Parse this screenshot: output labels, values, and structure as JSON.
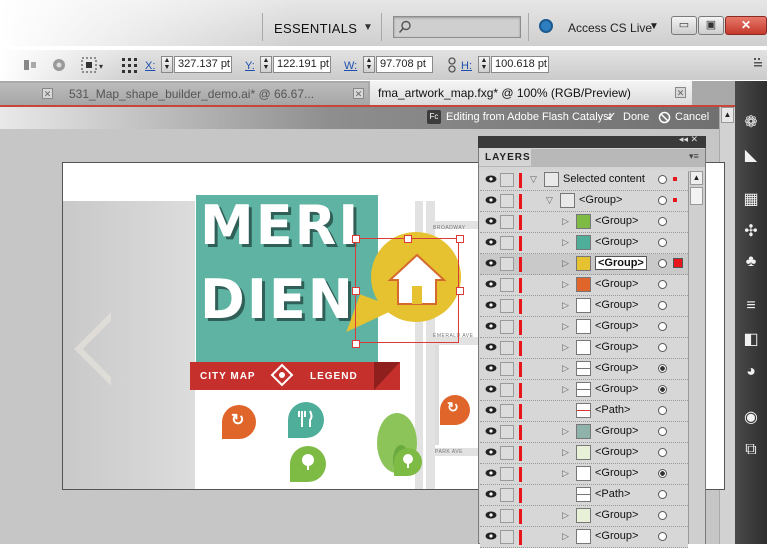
{
  "app": {
    "workspace": "ESSENTIALS",
    "search_placeholder": "",
    "cs_live": "Access CS Live",
    "window_buttons": {
      "minimize": "▭",
      "maximize": "▣",
      "close": "✕"
    }
  },
  "control_bar": {
    "x_label": "X:",
    "x_value": "327.137 pt",
    "y_label": "Y:",
    "y_value": "122.191 pt",
    "w_label": "W:",
    "w_value": "97.708 pt",
    "h_label": "H:",
    "h_value": "100.618 pt"
  },
  "tabs": [
    {
      "label": "531_Map_shape_builder_demo.ai* @ 66.67...",
      "active": false
    },
    {
      "label": "fma_artwork_map.fxg* @ 100% (RGB/Preview)",
      "active": true
    }
  ],
  "flash_bar": {
    "badge": "Fc",
    "text": "Editing from Adobe Flash Catalyst",
    "done": "Done",
    "cancel": "Cancel"
  },
  "layers_panel": {
    "title": "LAYERS",
    "rows": [
      {
        "label": "Selected content",
        "indent": 0,
        "expand": "down",
        "thumb": "folder",
        "target_filled": false
      },
      {
        "label": "<Group>",
        "indent": 1,
        "expand": "down",
        "thumb": "folder",
        "target_filled": false
      },
      {
        "label": "<Group>",
        "indent": 2,
        "expand": "right",
        "thumb": "green-pin",
        "target_filled": false
      },
      {
        "label": "<Group>",
        "indent": 2,
        "expand": "right",
        "thumb": "teal-pin",
        "target_filled": false
      },
      {
        "label": "<Group>",
        "indent": 2,
        "expand": "right",
        "thumb": "yellow-pin",
        "target_filled": false,
        "selected": true
      },
      {
        "label": "<Group>",
        "indent": 2,
        "expand": "right",
        "thumb": "orange-pin",
        "target_filled": false
      },
      {
        "label": "<Group>",
        "indent": 2,
        "expand": "right",
        "thumb": "blank",
        "target_filled": false
      },
      {
        "label": "<Group>",
        "indent": 2,
        "expand": "right",
        "thumb": "blank",
        "target_filled": false
      },
      {
        "label": "<Group>",
        "indent": 2,
        "expand": "right",
        "thumb": "blank",
        "target_filled": false
      },
      {
        "label": "<Group>",
        "indent": 2,
        "expand": "right",
        "thumb": "line",
        "target_filled": true
      },
      {
        "label": "<Group>",
        "indent": 2,
        "expand": "right",
        "thumb": "line",
        "target_filled": true
      },
      {
        "label": "<Path>",
        "indent": 2,
        "expand": "none",
        "thumb": "red-line",
        "target_filled": false
      },
      {
        "label": "<Group>",
        "indent": 2,
        "expand": "right",
        "thumb": "teal-box",
        "target_filled": false
      },
      {
        "label": "<Group>",
        "indent": 2,
        "expand": "right",
        "thumb": "green-leaf",
        "target_filled": false
      },
      {
        "label": "<Group>",
        "indent": 2,
        "expand": "right",
        "thumb": "blank",
        "target_filled": true
      },
      {
        "label": "<Path>",
        "indent": 2,
        "expand": "none",
        "thumb": "line",
        "target_filled": false
      },
      {
        "label": "<Group>",
        "indent": 2,
        "expand": "right",
        "thumb": "green-leaf",
        "target_filled": false
      },
      {
        "label": "<Group>",
        "indent": 2,
        "expand": "right",
        "thumb": "blank",
        "target_filled": false
      }
    ]
  },
  "artwork": {
    "title_line1": "MERI",
    "title_line2": "DIEN",
    "ribbon_left": "CITY MAP",
    "ribbon_right": "LEGEND",
    "streets": [
      "BROADWAY",
      "EMERALD AVE",
      "PARK AVE"
    ],
    "colors": {
      "teal": "#5fb3a2",
      "red": "#c5302c",
      "yellow": "#e6c130",
      "orange": "#e0652a",
      "green": "#7dbb45"
    }
  }
}
